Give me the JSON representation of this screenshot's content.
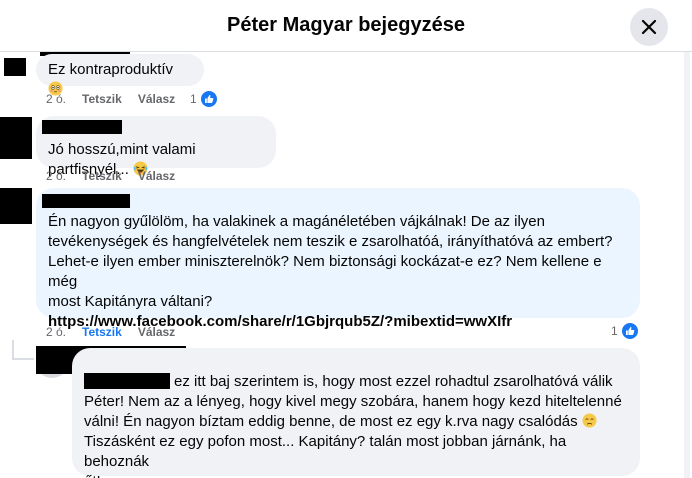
{
  "header": {
    "title": "Péter Magyar bejegyzése"
  },
  "comments": [
    {
      "text": "Ez kontraproduktív",
      "emoji": "flushed-face-emoji",
      "time": "2 ó.",
      "like_label": "Tetszik",
      "reply_label": "Válasz",
      "reaction_count": "1",
      "liked": false
    },
    {
      "text": "Jó hosszú,mint valami partfisnyél...",
      "emoji": "laughing-face-emoji",
      "time": "2 ó.",
      "like_label": "Tetszik",
      "reply_label": "Válasz",
      "reaction_count": "",
      "liked": false
    },
    {
      "text": "Én nagyon gyűlölöm, ha valakinek a magánéletében vájkálnak! De az ilyen\ntevékenységek és hangfelvételek nem teszik e zsarolhatóá, irányíthatóvá az embert?\nLehet-e ilyen ember miniszterelnök? Nem biztonsági kockázat-e ez? Nem kellene e még\nmost Kapitányra váltani?",
      "link": "https://www.facebook.com/share/r/1Gbjrqub5Z/?mibextid=wwXIfr",
      "time": "2 ó.",
      "like_label": "Tetszik",
      "reply_label": "Válasz",
      "reaction_count": "1",
      "liked": true
    },
    {
      "first_line": "ez itt baj szerintem is, hogy most ezzel rohadtul zsarolhatóvá válik",
      "text": "Péter! Nem az a lényeg, hogy kivel megy szobára, hanem hogy kezd hiteltelenné\nválni! Én nagyon bíztam eddig benne, de most ez egy k.rva nagy csalódás",
      "text_end": "Tiszásként ez egy pofon most... Kapitány? talán most jobban járnánk, ha behoznák\nőt!",
      "emoji": "disappointed-face-emoji"
    }
  ],
  "colors": {
    "accent": "#1877f2",
    "bubble_gray": "#f0f2f5",
    "bubble_blue": "#ebf5ff",
    "meta": "#65676b"
  }
}
